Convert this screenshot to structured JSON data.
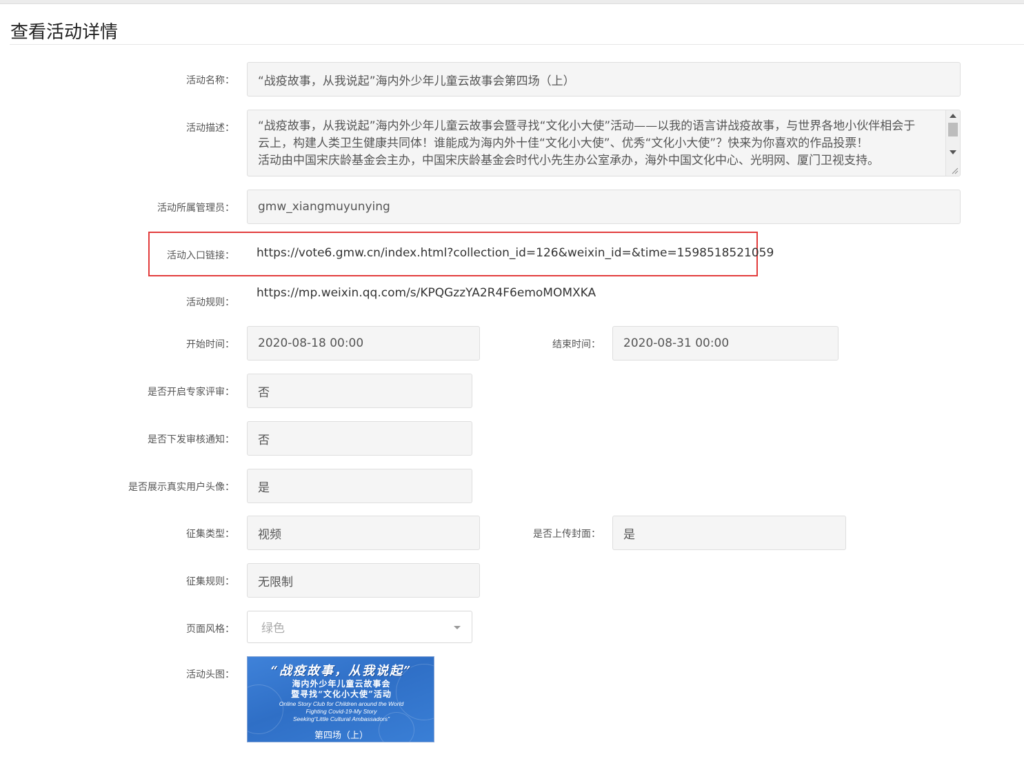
{
  "page": {
    "title": "查看活动详情"
  },
  "form": {
    "name": {
      "label": "活动名称：",
      "value": "“战疫故事，从我说起”海内外少年儿童云故事会第四场（上）"
    },
    "description": {
      "label": "活动描述：",
      "lines": [
        "“战疫故事，从我说起”海内外少年儿童云故事会暨寻找“文化小大使”活动——以我的语言讲战疫故事，与世界各地小伙伴相会于",
        "云上，构建人类卫生健康共同体！谁能成为海内外十佳“文化小大使”、优秀“文化小大使”？快来为你喜欢的作品投票！",
        "活动由中国宋庆龄基金会主办，中国宋庆龄基金会时代小先生办公室承办，海外中国文化中心、光明网、厦门卫视支持。"
      ]
    },
    "admin": {
      "label": "活动所属管理员：",
      "value": "gmw_xiangmuyunying"
    },
    "entry_link": {
      "label": "活动入口链接：",
      "value": "https://vote6.gmw.cn/index.html?collection_id=126&weixin_id=&time=1598518521059"
    },
    "rules_link": {
      "label": "活动规则：",
      "value": "https://mp.weixin.qq.com/s/KPQGzzYA2R4F6emoMOMXKA"
    },
    "start_time": {
      "label": "开始时间：",
      "value": "2020-08-18 00:00"
    },
    "end_time": {
      "label": "结束时间：",
      "value": "2020-08-31 00:00"
    },
    "expert_review": {
      "label": "是否开启专家评审：",
      "value": "否"
    },
    "review_notice": {
      "label": "是否下发审核通知：",
      "value": "否"
    },
    "show_avatar": {
      "label": "是否展示真实用户头像：",
      "value": "是"
    },
    "collect_type": {
      "label": "征集类型：",
      "value": "视频"
    },
    "upload_cover": {
      "label": "是否上传封面：",
      "value": "是"
    },
    "collect_rule": {
      "label": "征集规则：",
      "value": "无限制"
    },
    "page_style": {
      "label": "页面风格：",
      "value": "绿色"
    },
    "header_image": {
      "label": "活动头图：",
      "lines": [
        "“战疫故事，从我说起”",
        "海内外少年儿童云故事会",
        "暨寻找“文化小大使”活动",
        "Online Story Club for Children around the World",
        "Fighting Covid-19-My Story",
        "Seeking“Little Cultural Ambassadors”",
        "第四场（上）"
      ]
    }
  },
  "colors": {
    "highlight": "#e23b3b",
    "banner": "#3278d0",
    "field_bg": "#f5f5f5"
  }
}
